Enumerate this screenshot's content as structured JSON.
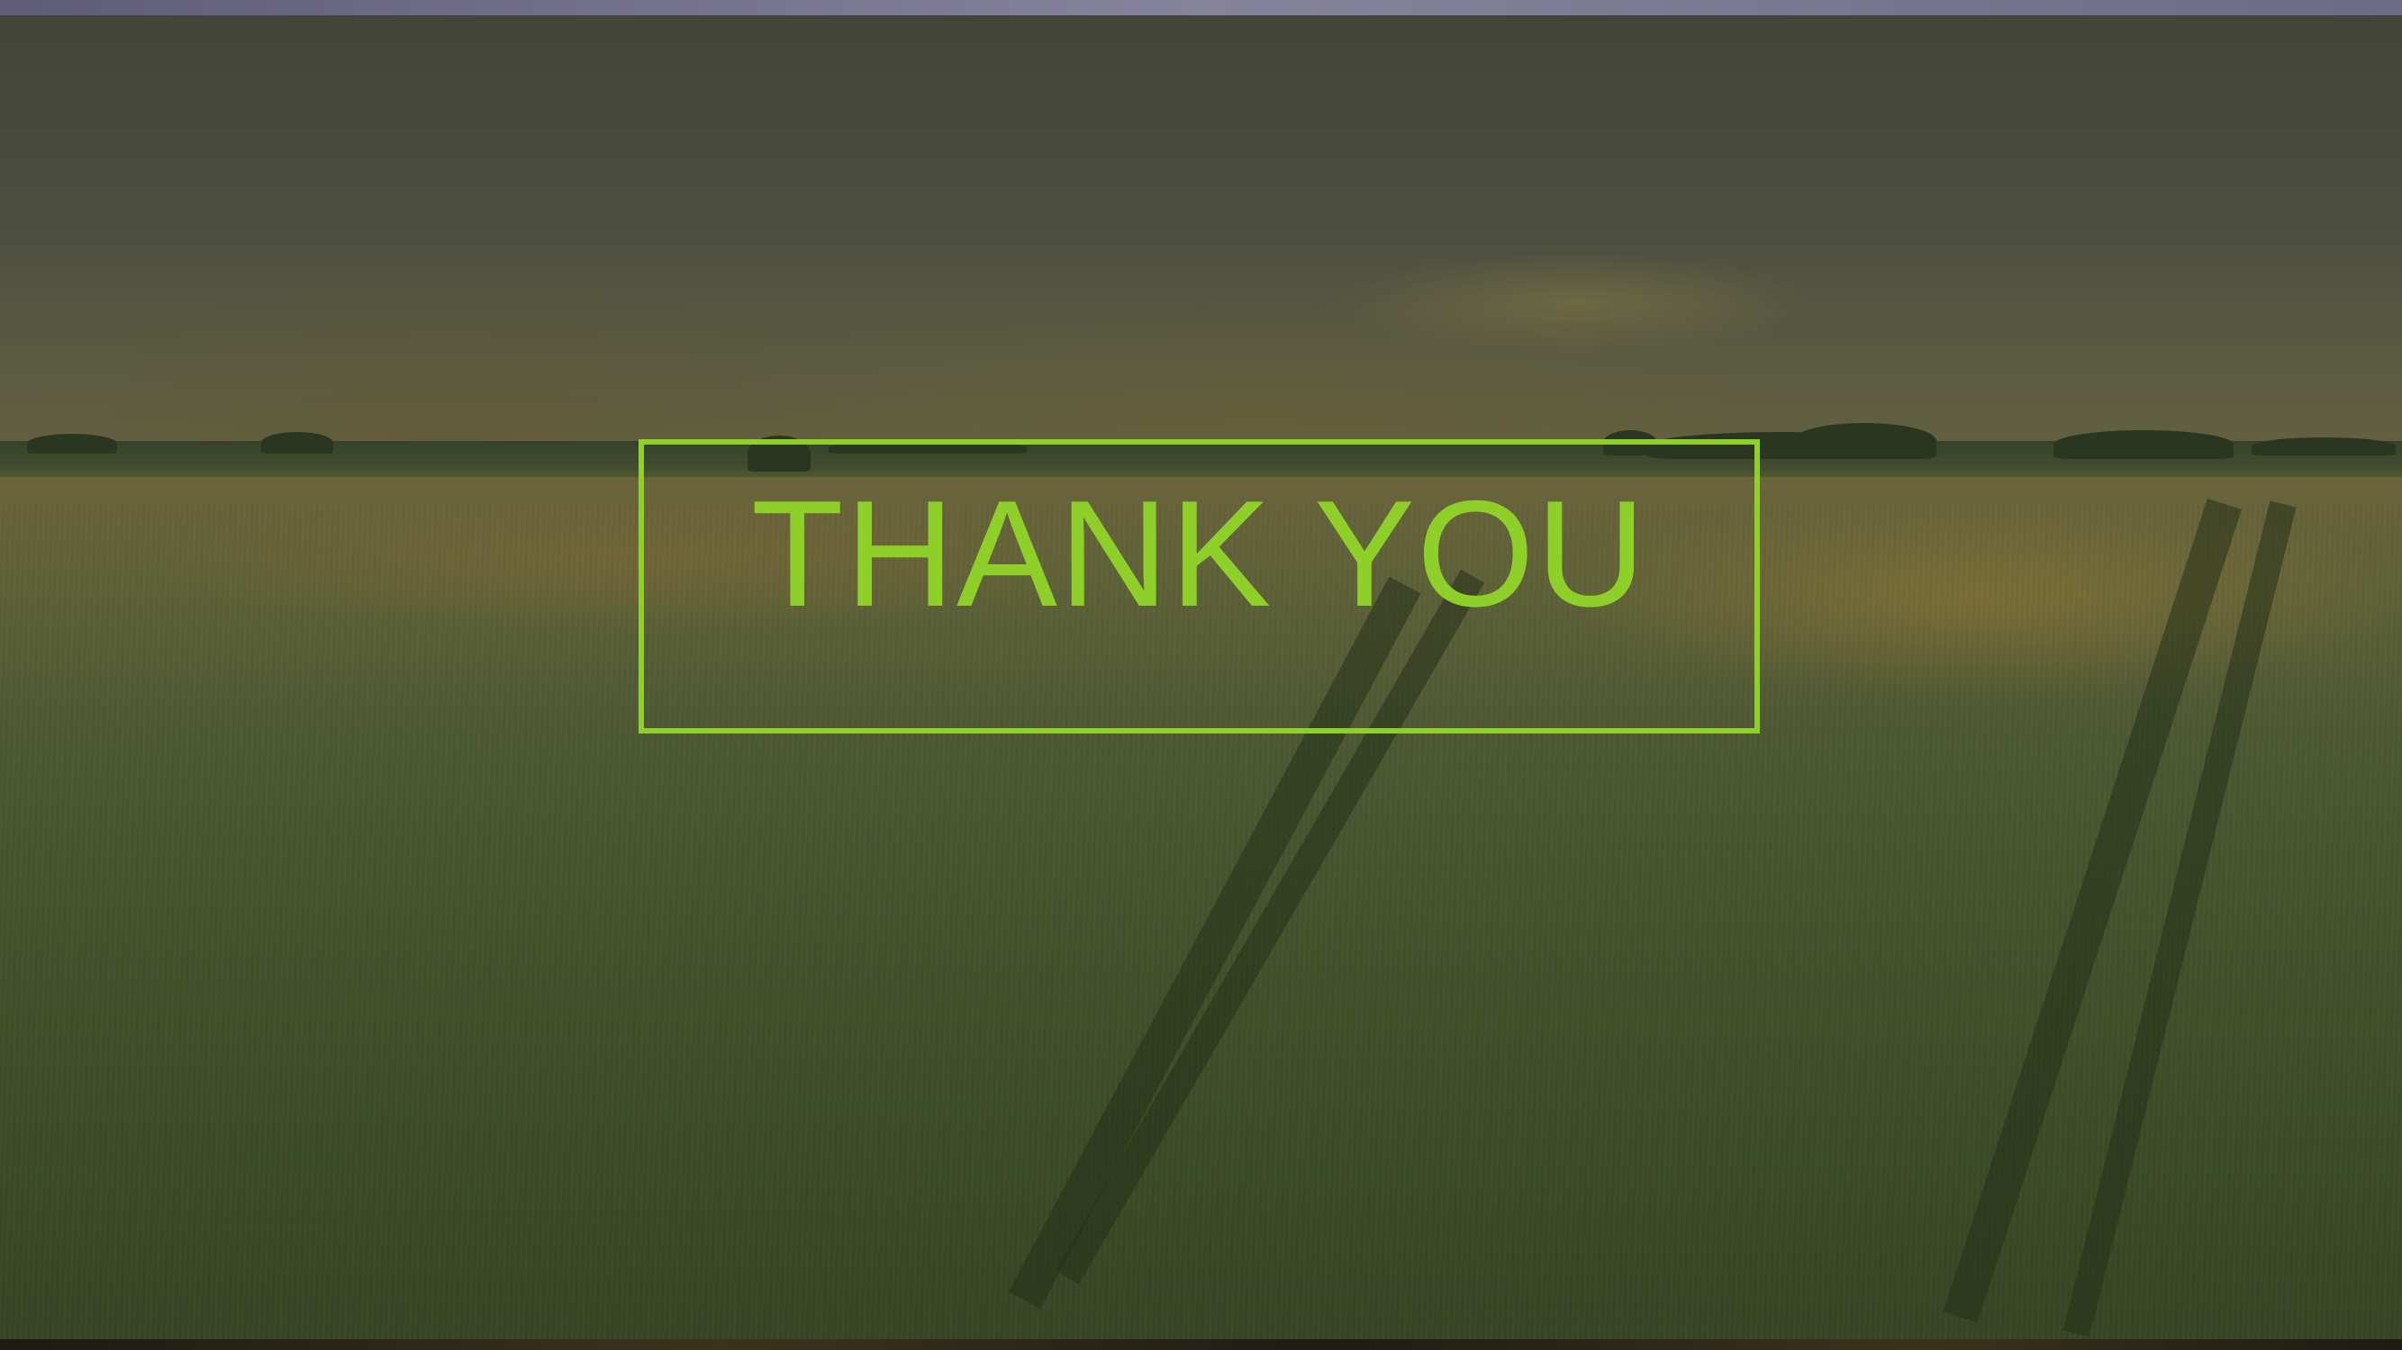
{
  "slide": {
    "title": "THANK YOU",
    "accent_color": "#8fcf2a",
    "background_image": "wheat-field-landscape"
  }
}
